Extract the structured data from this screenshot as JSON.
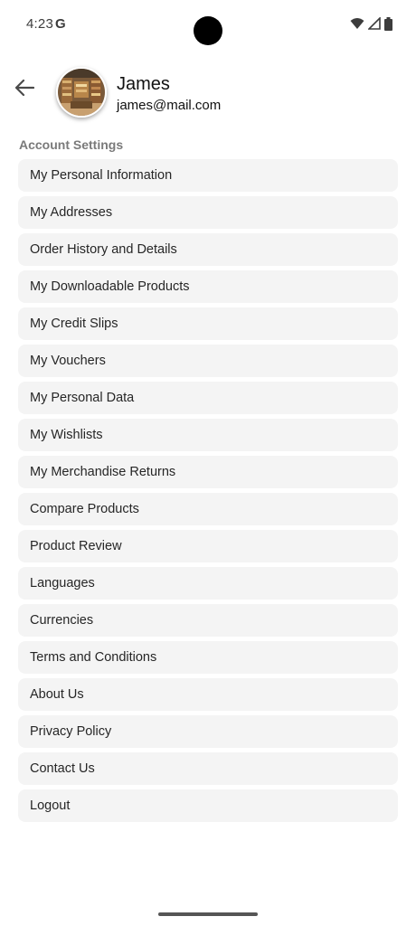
{
  "status_bar": {
    "time": "4:23",
    "google_glyph": "G",
    "icons": [
      "wifi-icon",
      "signal-icon",
      "battery-icon"
    ]
  },
  "header": {
    "back_icon": "arrow-back-icon",
    "user_name": "James",
    "user_email": "james@mail.com"
  },
  "section": {
    "title": "Account Settings"
  },
  "menu": {
    "items": [
      {
        "label": "My Personal Information"
      },
      {
        "label": "My Addresses"
      },
      {
        "label": "Order History and Details"
      },
      {
        "label": "My Downloadable Products"
      },
      {
        "label": "My Credit Slips"
      },
      {
        "label": "My Vouchers"
      },
      {
        "label": "My Personal Data"
      },
      {
        "label": "My Wishlists"
      },
      {
        "label": "My Merchandise Returns"
      },
      {
        "label": "Compare Products"
      },
      {
        "label": "Product Review"
      },
      {
        "label": "Languages"
      },
      {
        "label": "Currencies"
      },
      {
        "label": "Terms and Conditions"
      },
      {
        "label": "About Us"
      },
      {
        "label": "Privacy Policy"
      },
      {
        "label": "Contact Us"
      },
      {
        "label": "Logout"
      }
    ]
  },
  "colors": {
    "item_background": "#f4f4f4",
    "section_title": "#7a7a7a",
    "text": "#262626"
  }
}
